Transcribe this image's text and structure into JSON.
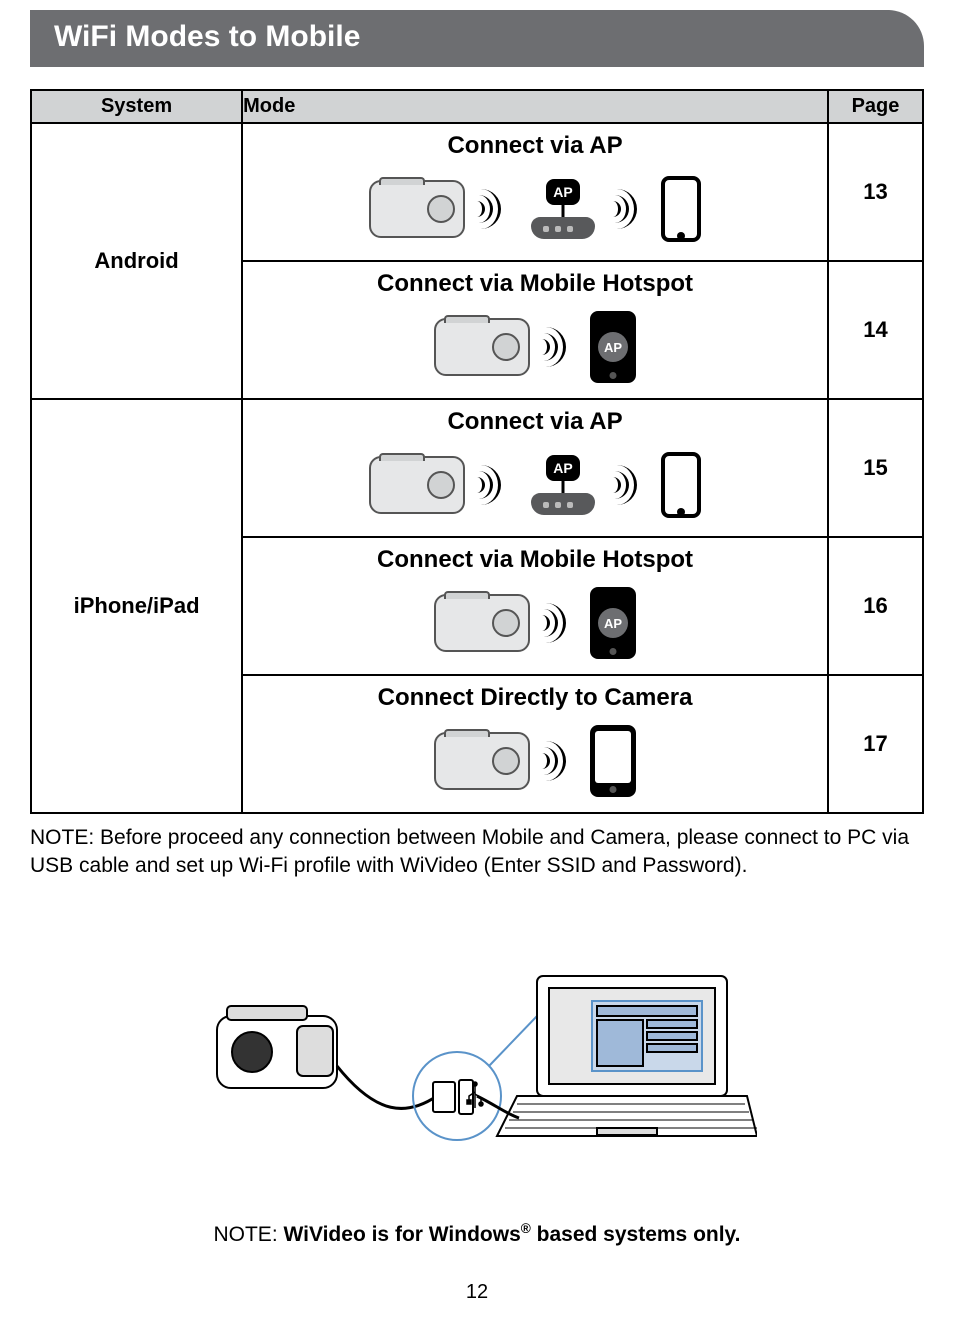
{
  "section_title": "WiFi Modes to Mobile",
  "table": {
    "headers": {
      "system": "System",
      "mode": "Mode",
      "page": "Page"
    },
    "groups": [
      {
        "system": "Android",
        "rows": [
          {
            "mode_title": "Connect via AP",
            "page": "13",
            "icons": "camera-waves-router-waves-phone"
          },
          {
            "mode_title": "Connect via Mobile Hotspot",
            "page": "14",
            "icons": "camera-waves-phoneap"
          }
        ]
      },
      {
        "system": "iPhone/iPad",
        "rows": [
          {
            "mode_title": "Connect via AP",
            "page": "15",
            "icons": "camera-waves-router-waves-phone"
          },
          {
            "mode_title": "Connect via Mobile Hotspot",
            "page": "16",
            "icons": "camera-waves-phoneap"
          },
          {
            "mode_title": "Connect Directly to Camera",
            "page": "17",
            "icons": "camera-waves-phoneempty"
          }
        ]
      }
    ]
  },
  "note1": "NOTE: Before proceed any connection between Mobile and Camera, please connect to PC via USB cable and set up Wi-Fi profile with WiVideo (Enter SSID and Password).",
  "note2_prefix": "NOTE: ",
  "note2_bold_a": "WiVideo is for Windows",
  "note2_reg": "®",
  "note2_bold_b": " based systems only.",
  "router_label": "AP",
  "phone_ap_label": "AP",
  "page_number": "12"
}
